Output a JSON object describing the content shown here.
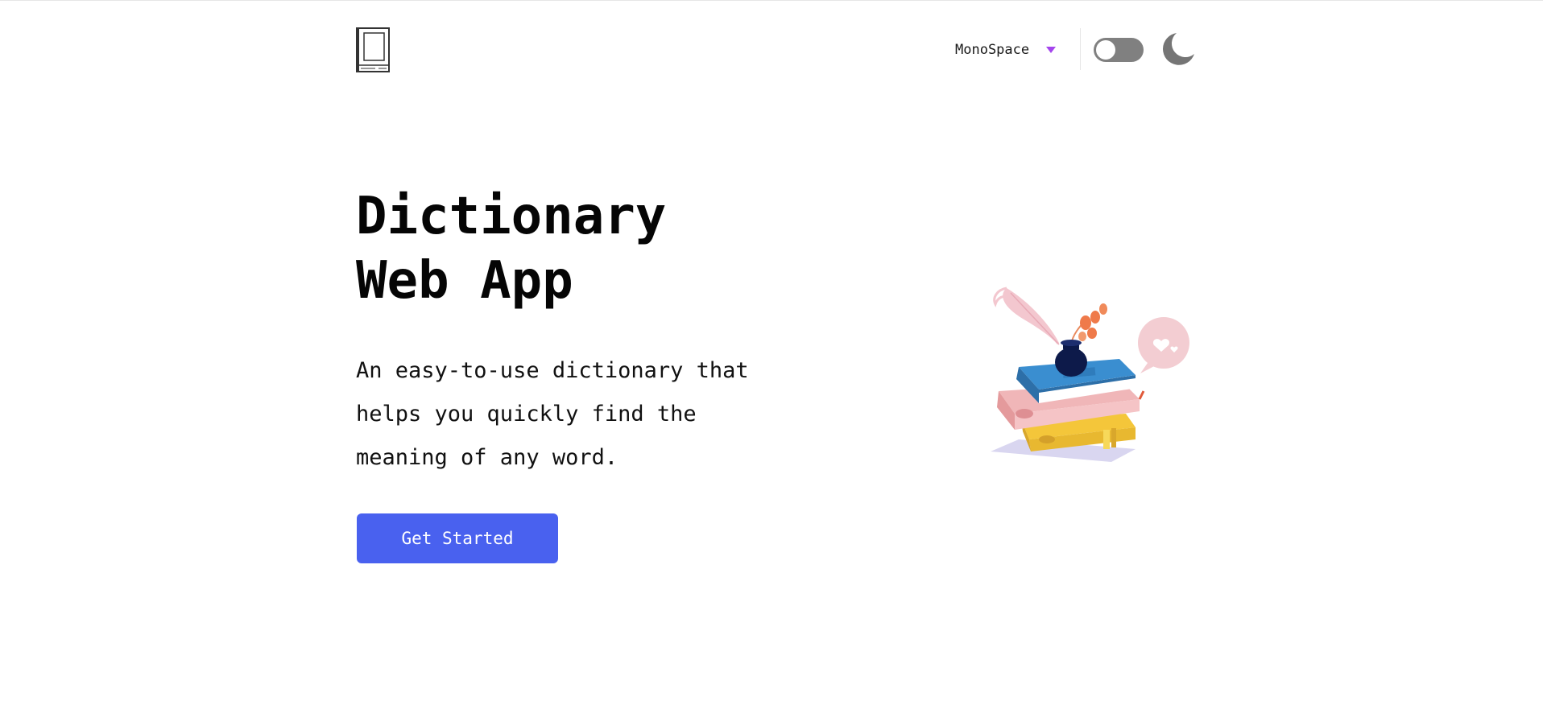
{
  "header": {
    "logo_icon": "book-icon",
    "font_selector": {
      "selected": "MonoSpace",
      "caret_color": "#a445ed",
      "caret_icon": "triangle-down-icon"
    },
    "theme_toggle": {
      "state": "off",
      "track_color": "#808080"
    },
    "moon_icon": "moon-icon"
  },
  "hero": {
    "title_line_1": "Dictionary",
    "title_line_2": "Web App",
    "description_line_1": "An easy-to-use dictionary that",
    "description_line_2": "helps you quickly find the",
    "description_line_3": "meaning of any word.",
    "cta_label": "Get Started",
    "cta_color": "#4961ef",
    "illustration": "books-stack-illustration"
  }
}
